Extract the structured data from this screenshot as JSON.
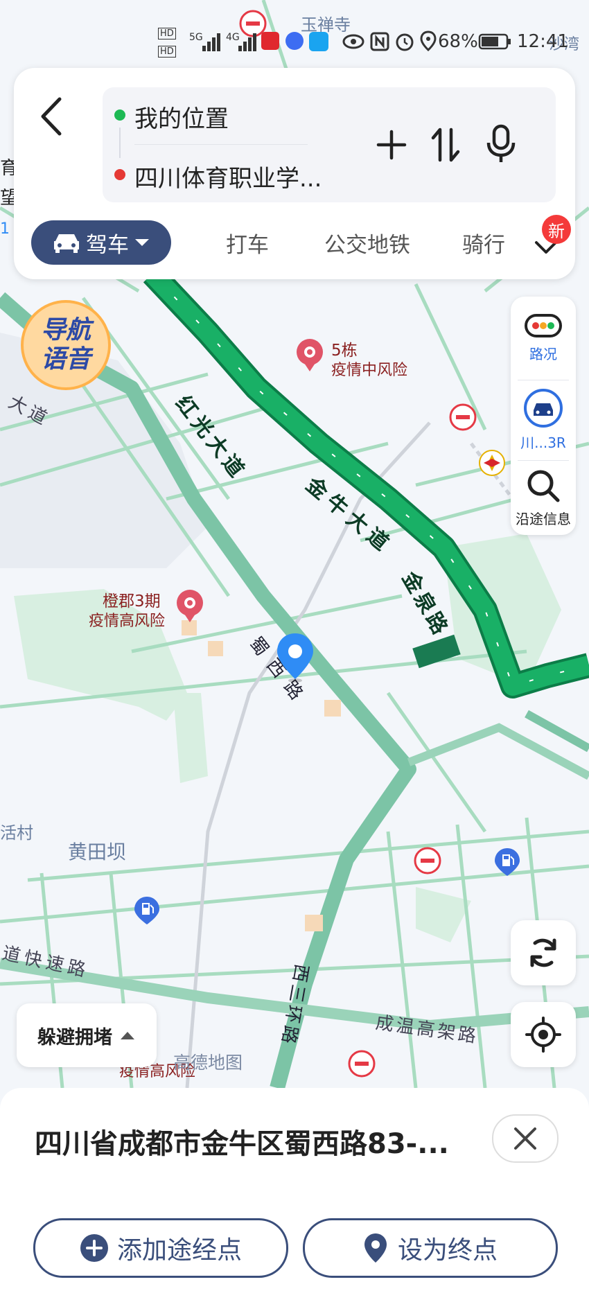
{
  "status_bar": {
    "battery_percent": "68%",
    "time": "12:41",
    "network_1": "5G",
    "network_2": "4G"
  },
  "route": {
    "origin": "我的位置",
    "destination": "四川体育职业学..."
  },
  "modes": {
    "drive": "驾车",
    "taxi": "打车",
    "transit": "公交地铁",
    "ride": "骑行",
    "new_badge": "新"
  },
  "side_tools": {
    "traffic": "路况",
    "vehicle": "川...3R",
    "along_route": "沿途信息"
  },
  "map": {
    "voice_badge_line1": "导航",
    "voice_badge_line2": "语音",
    "labels": {
      "yuchansi": "玉禅寺",
      "shawan": "沙湾",
      "hongguang": "红光大道",
      "jinniu": "金牛大道",
      "jinquan": "金泉路",
      "shuxi": "蜀西路",
      "west3ring": "西三环路",
      "chengwen": "成温高架路",
      "kuaisu": "道快速路",
      "dadao": "大道",
      "huangtianba": "黄田坝",
      "huocun": "活村",
      "building5": "5栋",
      "medium_risk": "疫情中风险",
      "chengjun": "橙郡3期",
      "high_risk": "疫情高风险",
      "high_risk_2": "疫情高风险",
      "watermark": "高德地图",
      "left_cut_1": "育",
      "left_cut_2": "望",
      "left_cut_3": "1"
    }
  },
  "avoid_congestion": "躲避拥堵",
  "bottom_sheet": {
    "address": "四川省成都市金牛区蜀西路83-...",
    "add_waypoint": "添加途经点",
    "set_destination": "设为终点"
  },
  "colors": {
    "accent": "#3a4e7b",
    "route_green": "#14a463",
    "origin_dot": "#1db954",
    "dest_dot": "#e53935",
    "pin_blue": "#2f8cf5",
    "road_main": "#7cc4a6"
  }
}
